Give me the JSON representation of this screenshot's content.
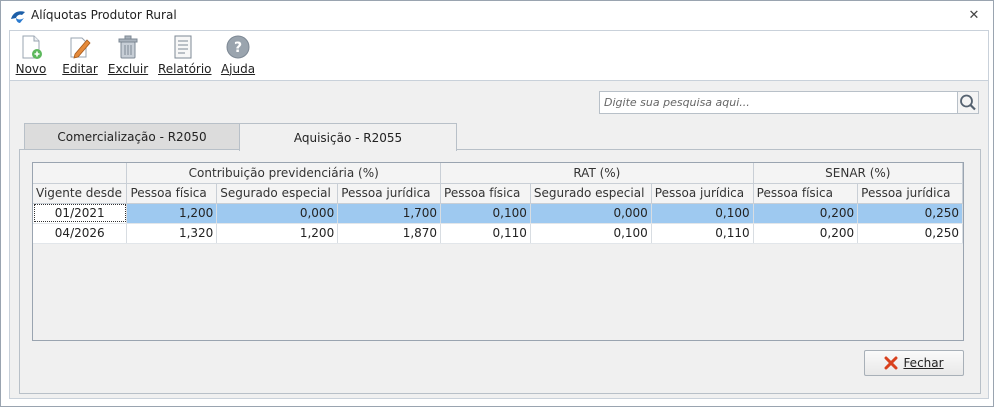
{
  "window": {
    "title": "Alíquotas Produtor Rural"
  },
  "toolbar": {
    "items": [
      {
        "label": "Novo"
      },
      {
        "label": "Editar"
      },
      {
        "label": "Excluir"
      },
      {
        "label": "Relatório"
      },
      {
        "label": "Ajuda"
      }
    ]
  },
  "search": {
    "placeholder": "Digite sua pesquisa aqui...",
    "value": ""
  },
  "tabs": [
    {
      "label": "Comercialização - R2050",
      "active": false
    },
    {
      "label": "Aquisição - R2055",
      "active": true
    }
  ],
  "grid": {
    "group_headers": [
      "",
      "Contribuição previdenciária (%)",
      "RAT (%)",
      "SENAR (%)"
    ],
    "columns": [
      "Vigente desde",
      "Pessoa física",
      "Segurado especial",
      "Pessoa jurídica",
      "Pessoa física",
      "Segurado especial",
      "Pessoa jurídica",
      "Pessoa física",
      "Pessoa jurídica"
    ],
    "rows": [
      {
        "cells": [
          "01/2021",
          "1,200",
          "0,000",
          "1,700",
          "0,100",
          "0,000",
          "0,100",
          "0,200",
          "0,250"
        ],
        "selected": true
      },
      {
        "cells": [
          "04/2026",
          "1,320",
          "1,200",
          "1,870",
          "0,110",
          "0,100",
          "0,110",
          "0,200",
          "0,250"
        ],
        "selected": false
      }
    ]
  },
  "buttons": {
    "close_label": "Fechar"
  },
  "colors": {
    "selection": "#9ec9f0",
    "tab_active": "#f0f0f0",
    "tab_inactive": "#dcdcdc"
  },
  "icons": [
    "app-logo-icon",
    "close-window-icon",
    "new-document-icon",
    "edit-pencil-icon",
    "trash-icon",
    "report-icon",
    "help-icon",
    "search-icon",
    "close-red-x-icon"
  ]
}
